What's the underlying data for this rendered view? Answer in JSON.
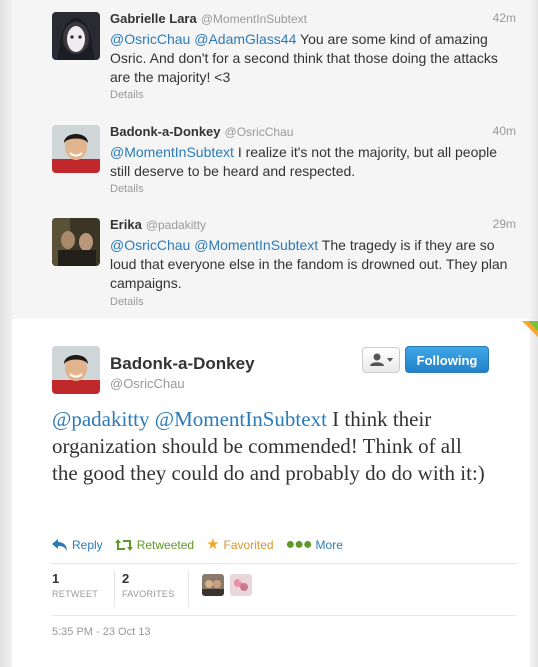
{
  "replies": [
    {
      "name": "Gabrielle Lara",
      "handle": "@MomentInSubtext",
      "time": "42m",
      "segments": [
        {
          "text": "@OsricChau",
          "mention": true
        },
        {
          "text": " ",
          "mention": false
        },
        {
          "text": "@AdamGlass44",
          "mention": true
        },
        {
          "text": " You are some kind of amazing Osric. And don't for a second think that those doing the attacks are the majority! <3",
          "mention": false
        }
      ],
      "details": "Details"
    },
    {
      "name": "Badonk-a-Donkey",
      "handle": "@OsricChau",
      "time": "40m",
      "segments": [
        {
          "text": "@MomentInSubtext",
          "mention": true
        },
        {
          "text": " I realize it's not the majority, but all people still deserve to be heard and respected.",
          "mention": false
        }
      ],
      "details": "Details"
    },
    {
      "name": "Erika",
      "handle": "@padakitty",
      "time": "29m",
      "segments": [
        {
          "text": "@OsricChau",
          "mention": true
        },
        {
          "text": " ",
          "mention": false
        },
        {
          "text": "@MomentInSubtext",
          "mention": true
        },
        {
          "text": "  The tragedy is if they are so loud that everyone else in the fandom is drowned out. They plan campaigns.",
          "mention": false
        }
      ],
      "details": "Details"
    }
  ],
  "main": {
    "name": "Badonk-a-Donkey",
    "handle": "@OsricChau",
    "follow_label": "Following",
    "user_menu_icon": "user-dropdown-icon",
    "text": {
      "mention1": "@padakitty",
      "mention2": "@MomentInSubtext",
      "body": " I think their organization should be commended! Think of all the good they could do and probably do do with it:)"
    },
    "actions": {
      "reply": "Reply",
      "retweeted": "Retweeted",
      "favorited": "Favorited",
      "more": "More"
    },
    "stats": {
      "retweets_count": "1",
      "retweets_label": "RETWEET",
      "favorites_count": "2",
      "favorites_label": "FAVORITES"
    },
    "timestamp": "5:35 PM - 23 Oct 13"
  },
  "colors": {
    "link": "#2b7bb9",
    "retweet": "#609928",
    "favorite": "#d9962a",
    "follow_button": "#2281c9"
  }
}
